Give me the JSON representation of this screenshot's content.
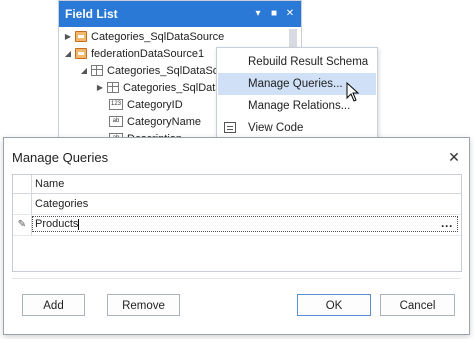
{
  "field_list": {
    "title": "Field List",
    "header_buttons": {
      "dropdown": "▾",
      "pin": "■",
      "close": "✕"
    },
    "tree": [
      {
        "label": "Categories_SqlDataSource",
        "icon": "datasource-icon",
        "expanded": false
      },
      {
        "label": "federationDataSource1",
        "icon": "datasource-icon",
        "expanded": true
      },
      {
        "label": "Categories_SqlDataSour",
        "icon": "table-icon",
        "expanded": true
      },
      {
        "label": "Categories_SqlDataS",
        "icon": "table-icon",
        "expanded": false
      },
      {
        "label": "CategoryID",
        "icon": "number-field-icon",
        "badge": "123"
      },
      {
        "label": "CategoryName",
        "icon": "string-field-icon",
        "badge": "ab"
      },
      {
        "label": "Description",
        "icon": "string-field-icon",
        "badge": "ab"
      }
    ]
  },
  "context_menu": {
    "items": [
      {
        "label": "Rebuild Result Schema",
        "hovered": false
      },
      {
        "label": "Manage Queries...",
        "hovered": true
      },
      {
        "label": "Manage Relations...",
        "hovered": false
      },
      {
        "label": "View Code",
        "hovered": false,
        "icon": "view-code-icon"
      }
    ]
  },
  "dialog": {
    "title": "Manage Queries",
    "close": "✕",
    "grid": {
      "column": "Name",
      "rows": [
        {
          "name": "Categories",
          "editing": false
        },
        {
          "name": "Products",
          "editing": true,
          "indicator": "✎",
          "ellipsis": "···"
        }
      ]
    },
    "buttons": {
      "add": "Add",
      "remove": "Remove",
      "ok": "OK",
      "cancel": "Cancel"
    }
  },
  "colors": {
    "accent": "#2b79d7",
    "menu_hover": "#cfe0f7"
  }
}
